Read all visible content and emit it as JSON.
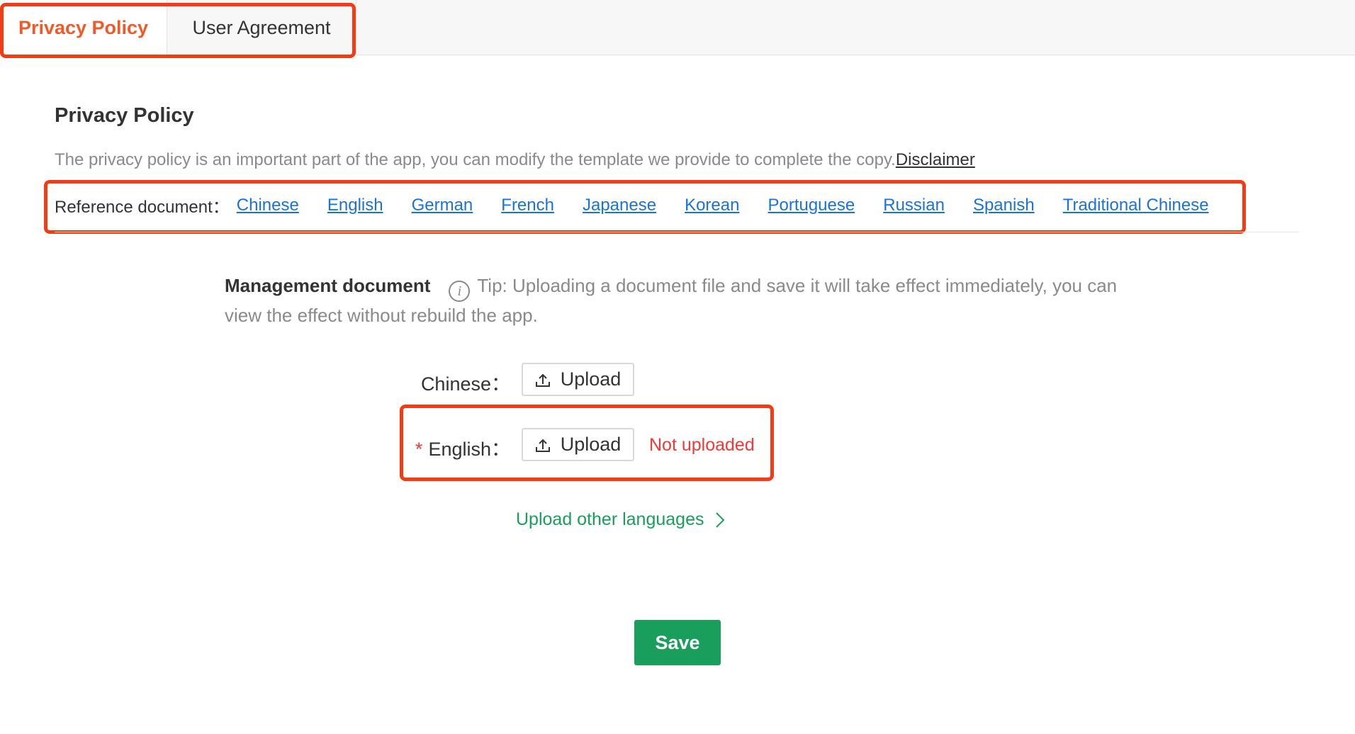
{
  "tabs": [
    {
      "label": "Privacy Policy",
      "active": true
    },
    {
      "label": "User Agreement",
      "active": false
    }
  ],
  "section": {
    "title": "Privacy Policy",
    "description": "The privacy policy is an important part of the app, you can modify the template we provide to complete the copy.",
    "disclaimer_link": "Disclaimer"
  },
  "reference": {
    "label": "Reference document：",
    "links": [
      "Chinese",
      "English",
      "German",
      "French",
      "Japanese",
      "Korean",
      "Portuguese",
      "Russian",
      "Spanish",
      "Traditional Chinese"
    ]
  },
  "management": {
    "title": "Management document",
    "tip": "Tip: Uploading a document file and save it will take effect immediately, you can view the effect without rebuild the app.",
    "info_icon_glyph": "i"
  },
  "uploads": [
    {
      "label": "Chinese：",
      "button_label": "Upload",
      "required": false,
      "status": ""
    },
    {
      "label": "English：",
      "button_label": "Upload",
      "required": true,
      "required_mark": "*",
      "status": "Not uploaded"
    }
  ],
  "upload_other": {
    "label": "Upload other languages"
  },
  "save_button": {
    "label": "Save"
  },
  "colors": {
    "brand_orange": "#f05a28",
    "highlight_red": "#f23c16",
    "link_blue": "#1a73d9",
    "primary_green": "#1a9e5c",
    "error_red": "#f03a3a"
  },
  "icons": {
    "info": "info-icon",
    "upload": "upload-icon",
    "chevron": "chevron-right-icon"
  }
}
